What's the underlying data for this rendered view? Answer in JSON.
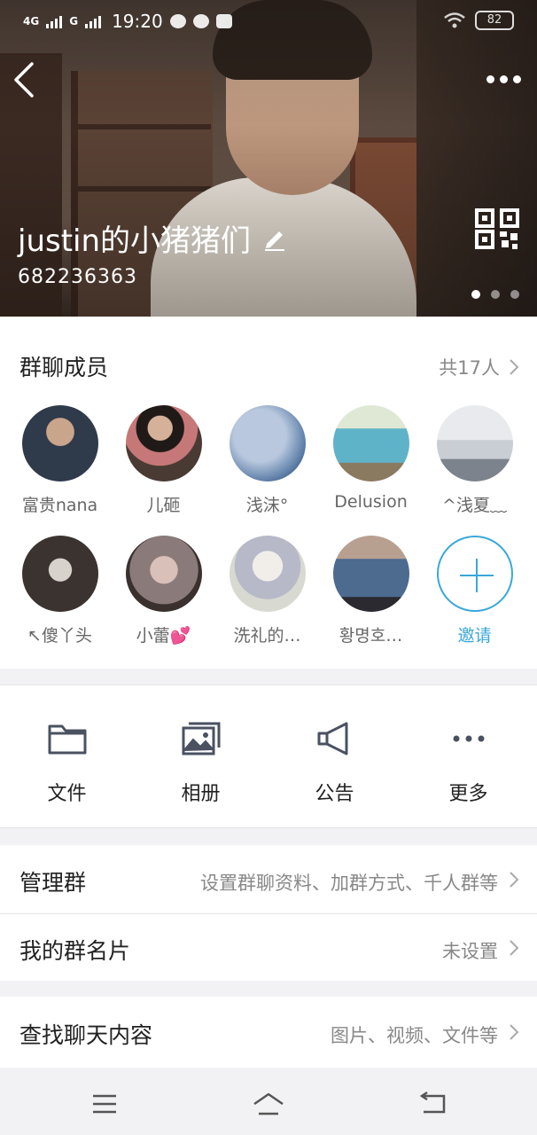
{
  "status_bar": {
    "network_1": "4G",
    "network_2": "G",
    "time": "19:20",
    "battery": "82"
  },
  "header": {
    "group_name": "justin的小猪猪们",
    "group_id": "682236363",
    "carousel_pages": 3,
    "carousel_active": 1
  },
  "members_section": {
    "title": "群聊成员",
    "count_label": "共17人",
    "members": [
      {
        "name": "富贵nana",
        "avatar_color": "#2f3a4a"
      },
      {
        "name": "儿砸",
        "avatar_color": "#4a3a34"
      },
      {
        "name": "浅沫°",
        "avatar_color": "#5d7fa8"
      },
      {
        "name": "Delusion",
        "avatar_color": "#5fb3c9"
      },
      {
        "name": "^浅夏﹏",
        "avatar_color": "#c9cdd4"
      },
      {
        "name": "↖傻丫头",
        "avatar_color": "#3b3330"
      },
      {
        "name": "小蕾💕",
        "avatar_color": "#8a7b7a"
      },
      {
        "name": "洗礼的…",
        "avatar_color": "#d8d9d0"
      },
      {
        "name": "황명호…",
        "avatar_color": "#4d6a8f"
      }
    ],
    "invite_label": "邀请"
  },
  "tools": [
    {
      "label": "文件",
      "icon": "folder-icon"
    },
    {
      "label": "相册",
      "icon": "album-icon"
    },
    {
      "label": "公告",
      "icon": "megaphone-icon"
    },
    {
      "label": "更多",
      "icon": "more-dots-icon"
    }
  ],
  "rows": {
    "manage": {
      "title": "管理群",
      "value": "设置群聊资料、加群方式、千人群等"
    },
    "card": {
      "title": "我的群名片",
      "value": "未设置"
    },
    "search": {
      "title": "查找聊天内容",
      "value": "图片、视频、文件等"
    }
  },
  "colors": {
    "accent": "#39a7d9",
    "icon_gray": "#4a5160",
    "secondary_text": "#888888"
  }
}
